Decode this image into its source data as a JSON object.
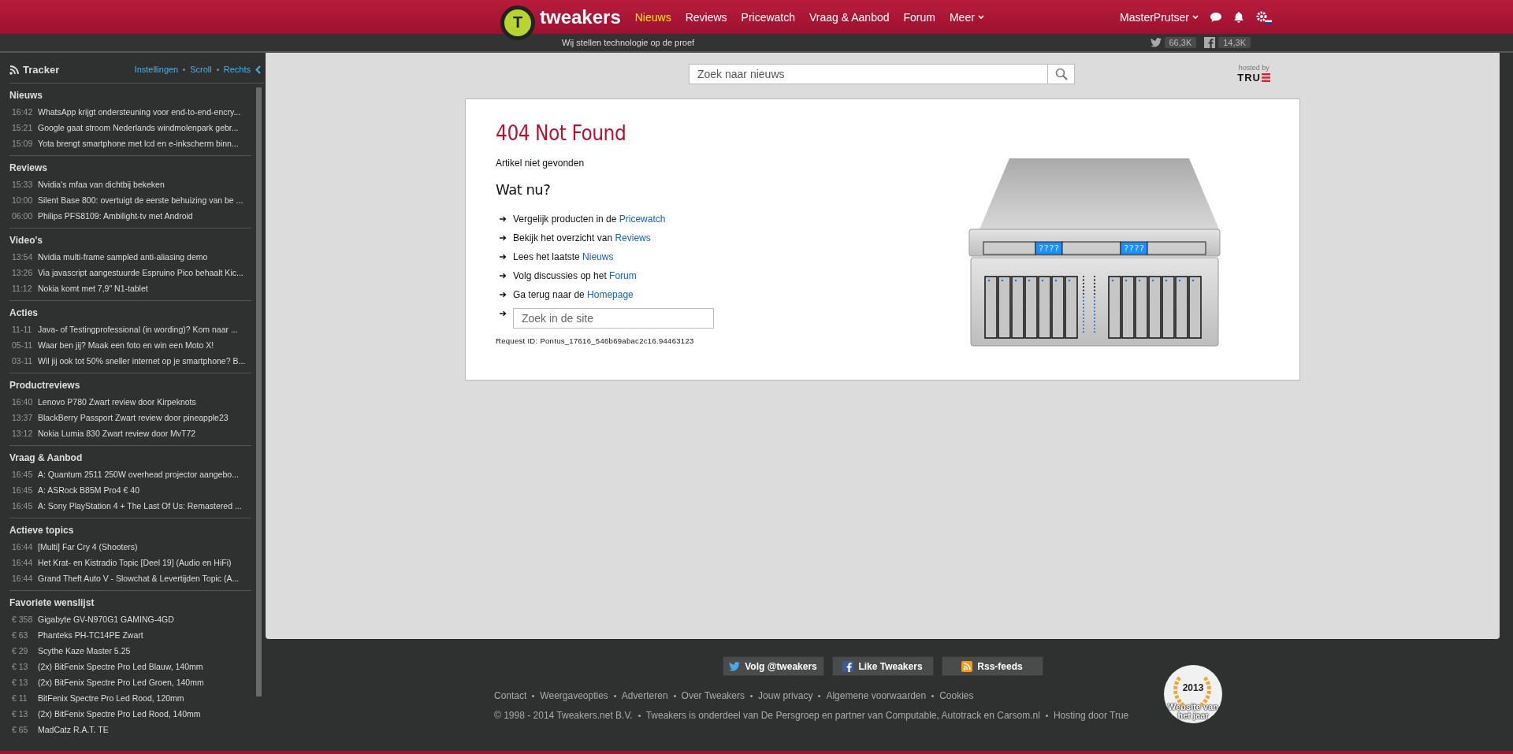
{
  "header": {
    "logo_letter": "T",
    "logo_text": "tweakers",
    "tagline": "Wij stellen technologie op de proef",
    "nav": [
      {
        "label": "Nieuws",
        "selected": true,
        "caret": false
      },
      {
        "label": "Reviews",
        "selected": false,
        "caret": false
      },
      {
        "label": "Pricewatch",
        "selected": false,
        "caret": false
      },
      {
        "label": "Vraag & Aanbod",
        "selected": false,
        "caret": false
      },
      {
        "label": "Forum",
        "selected": false,
        "caret": false
      },
      {
        "label": "Meer",
        "selected": false,
        "caret": true
      }
    ],
    "user": "MasterPrutser",
    "twitter_count": "66,3K",
    "facebook_count": "14,3K"
  },
  "tracker": {
    "title": "Tracker",
    "links": [
      "Instellingen",
      "Scroll",
      "Rechts"
    ],
    "sections": [
      {
        "title": "Nieuws",
        "items": [
          {
            "meta": "16:42",
            "text": "WhatsApp krijgt ondersteuning voor end-to-end-encry..."
          },
          {
            "meta": "15:21",
            "text": "Google gaat stroom Nederlands windmolenpark gebr..."
          },
          {
            "meta": "15:09",
            "text": "Yota brengt smartphone met lcd en e-inkscherm binn..."
          }
        ]
      },
      {
        "title": "Reviews",
        "items": [
          {
            "meta": "15:33",
            "text": "Nvidia's mfaa van dichtbij bekeken"
          },
          {
            "meta": "10:00",
            "text": "Silent Base 800: overtuigt de eerste behuizing van be ..."
          },
          {
            "meta": "06:00",
            "text": "Philips PFS8109: Ambilight-tv met Android"
          }
        ]
      },
      {
        "title": "Video's",
        "items": [
          {
            "meta": "13:54",
            "text": "Nvidia multi-frame sampled anti-aliasing demo"
          },
          {
            "meta": "13:26",
            "text": "Via javascript aangestuurde Espruino Pico behaalt Kic..."
          },
          {
            "meta": "11:12",
            "text": "Nokia komt met 7,9\" N1-tablet"
          }
        ]
      },
      {
        "title": "Acties",
        "items": [
          {
            "meta": "11-11",
            "text": "Java- of Testingprofessional (in wording)? Kom naar ..."
          },
          {
            "meta": "05-11",
            "text": "Waar ben jij? Maak een foto en win een Moto X!"
          },
          {
            "meta": "03-11",
            "text": "Wil jij ook tot 50% sneller internet op je smartphone? B..."
          }
        ]
      },
      {
        "title": "Productreviews",
        "items": [
          {
            "meta": "16:40",
            "text": "Lenovo P780 Zwart review door Kirpeknots"
          },
          {
            "meta": "13:37",
            "text": "BlackBerry Passport Zwart review door pineapple23"
          },
          {
            "meta": "13:12",
            "text": "Nokia Lumia 830 Zwart review door MvT72"
          }
        ]
      },
      {
        "title": "Vraag & Aanbod",
        "items": [
          {
            "meta": "16:45",
            "text": "A: Quantum 2511 250W overhead projector aangebo..."
          },
          {
            "meta": "16:45",
            "text": "A: ASRock B85M Pro4 € 40"
          },
          {
            "meta": "16:45",
            "text": "A: Sony PlayStation 4 + The Last Of Us: Remastered ..."
          }
        ]
      },
      {
        "title": "Actieve topics",
        "items": [
          {
            "meta": "16:44",
            "text": "[Multi] Far Cry 4 (Shooters)"
          },
          {
            "meta": "16:44",
            "text": "Het Krat- en Kistradio Topic [Deel 19] (Audio en HiFi)"
          },
          {
            "meta": "16:44",
            "text": "Grand Theft Auto V - Slowchat & Levertijden Topic (A..."
          }
        ]
      },
      {
        "title": "Favoriete wenslijst",
        "items": [
          {
            "meta": "€ 358",
            "text": "Gigabyte GV-N970G1 GAMING-4GD"
          },
          {
            "meta": "€ 63",
            "text": "Phanteks PH-TC14PE Zwart"
          },
          {
            "meta": "€ 29",
            "text": "Scythe Kaze Master 5.25"
          },
          {
            "meta": "€ 13",
            "text": "(2x) BitFenix Spectre Pro Led Blauw, 140mm"
          },
          {
            "meta": "€ 13",
            "text": "(2x) BitFenix Spectre Pro Led Groen, 140mm"
          },
          {
            "meta": "€ 11",
            "text": "BitFenix Spectre Pro Led Rood, 120mm"
          },
          {
            "meta": "€ 13",
            "text": "(2x) BitFenix Spectre Pro Led Rood, 140mm"
          },
          {
            "meta": "€ 65",
            "text": "MadCatz R.A.T. TE"
          }
        ]
      }
    ]
  },
  "search": {
    "placeholder": "Zoek naar nieuws"
  },
  "hosted": {
    "label": "hosted by",
    "brand": "TRU"
  },
  "error": {
    "title": "404 Not Found",
    "subtitle": "Artikel niet gevonden",
    "heading": "Wat nu?",
    "options": [
      {
        "text": "Vergelijk producten in de",
        "link": "Pricewatch"
      },
      {
        "text": "Bekijk het overzicht van",
        "link": "Reviews"
      },
      {
        "text": "Lees het laatste",
        "link": "Nieuws"
      },
      {
        "text": "Volg discussies op het",
        "link": "Forum"
      },
      {
        "text": "Ga terug naar de",
        "link": "Homepage"
      }
    ],
    "site_search_placeholder": "Zoek in de site",
    "request_id": "Request ID: Pontus_17616_546b69abac2c16.94463123",
    "server_displays": [
      "????",
      "????"
    ]
  },
  "footer": {
    "buttons": [
      {
        "kind": "twitter",
        "label": "Volg @tweakers"
      },
      {
        "kind": "facebook",
        "label": "Like Tweakers"
      },
      {
        "kind": "rss",
        "label": "Rss-feeds"
      }
    ],
    "links": [
      "Contact",
      "Weergaveopties",
      "Adverteren",
      "Over Tweakers",
      "Jouw privacy",
      "Algemene voorwaarden",
      "Cookies"
    ],
    "credits": [
      "© 1998 - 2014 Tweakers.net B.V.",
      "Tweakers is onderdeel van De Persgroep en partner van Computable, Autotrack en Carsom.nl",
      "Hosting door True"
    ],
    "award": {
      "year": "2013",
      "line1": "Website van",
      "line2": "het jaar"
    }
  }
}
